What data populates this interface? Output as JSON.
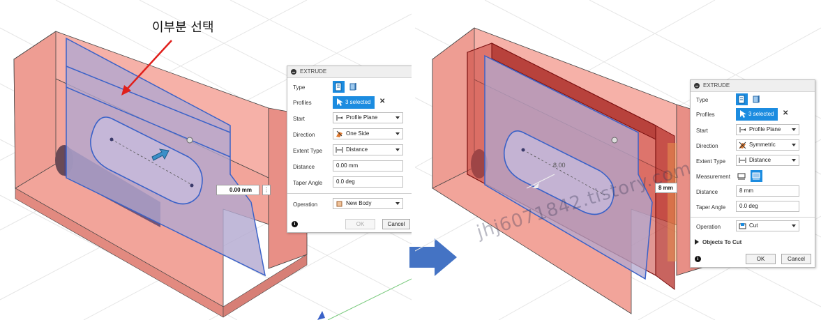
{
  "annotation": {
    "text": "이부분 선택"
  },
  "watermark": {
    "text": "jhj6071842.tistory.com"
  },
  "left": {
    "dimension_value": "0.00 mm",
    "more_glyph": "⋮",
    "panel": {
      "title": "EXTRUDE",
      "type_label": "Type",
      "profiles_label": "Profiles",
      "profiles_value": "3 selected",
      "clear_glyph": "✕",
      "start_label": "Start",
      "start_value": "Profile Plane",
      "direction_label": "Direction",
      "direction_value": "One Side",
      "extent_type_label": "Extent Type",
      "extent_type_value": "Distance",
      "distance_label": "Distance",
      "distance_value": "0.00 mm",
      "taper_label": "Taper Angle",
      "taper_value": "0.0 deg",
      "operation_label": "Operation",
      "operation_value": "New Body",
      "info_glyph": "i",
      "ok_label": "OK",
      "cancel_label": "Cancel"
    }
  },
  "right": {
    "dimension_value": "8 mm",
    "float_dimension": "8.00",
    "panel": {
      "title": "EXTRUDE",
      "type_label": "Type",
      "profiles_label": "Profiles",
      "profiles_value": "3 selected",
      "clear_glyph": "✕",
      "start_label": "Start",
      "start_value": "Profile Plane",
      "direction_label": "Direction",
      "direction_value": "Symmetric",
      "extent_type_label": "Extent Type",
      "extent_type_value": "Distance",
      "measurement_label": "Measurement",
      "distance_label": "Distance",
      "distance_value": "8 mm",
      "taper_label": "Taper Angle",
      "taper_value": "0.0 deg",
      "operation_label": "Operation",
      "operation_value": "Cut",
      "objects_to_cut_label": "Objects To Cut",
      "info_glyph": "i",
      "ok_label": "OK",
      "cancel_label": "Cancel"
    }
  },
  "colors": {
    "body_fill": "#f2a49a",
    "body_side": "#e88f86",
    "profile_fill": "#a9a2c4",
    "sketch_line": "#3a62c8",
    "accent": "#1c8ce0",
    "flow_arrow": "#4473c4",
    "red_arrow": "#e0201c"
  },
  "icons": {
    "annotation_arrow": "red-arrow-icon",
    "flow_arrow": "blue-right-arrow-icon",
    "manipulator": "blue-drag-arrow-icon"
  }
}
